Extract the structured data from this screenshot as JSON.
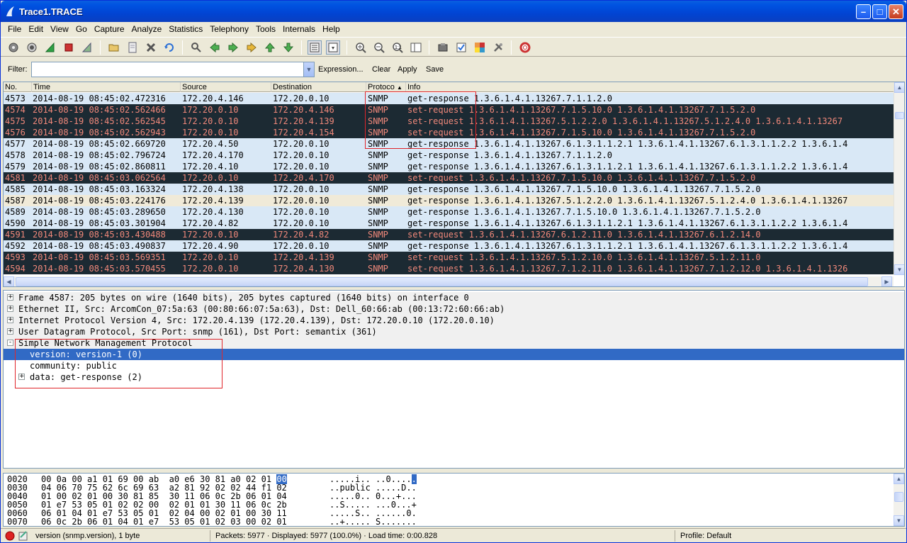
{
  "window": {
    "title": "Trace1.TRACE"
  },
  "menu": [
    "File",
    "Edit",
    "View",
    "Go",
    "Capture",
    "Analyze",
    "Statistics",
    "Telephony",
    "Tools",
    "Internals",
    "Help"
  ],
  "filter": {
    "label": "Filter:",
    "value": "",
    "expression": "Expression...",
    "clear": "Clear",
    "apply": "Apply",
    "save": "Save"
  },
  "packet_list": {
    "columns": [
      "No.",
      "Time",
      "Source",
      "Destination",
      "Protoco",
      "Info"
    ],
    "rows": [
      {
        "no": "4573",
        "time": "2014-08-19 08:45:02.472316",
        "src": "172.20.4.146",
        "dst": "172.20.0.10",
        "proto": "SNMP",
        "info": "get-response 1.3.6.1.4.1.13267.7.1.1.2.0",
        "kind": "resp"
      },
      {
        "no": "4574",
        "time": "2014-08-19 08:45:02.562466",
        "src": "172.20.0.10",
        "dst": "172.20.4.146",
        "proto": "SNMP",
        "info": "set-request 1.3.6.1.4.1.13267.7.1.5.10.0 1.3.6.1.4.1.13267.7.1.5.2.0",
        "kind": "req"
      },
      {
        "no": "4575",
        "time": "2014-08-19 08:45:02.562545",
        "src": "172.20.0.10",
        "dst": "172.20.4.139",
        "proto": "SNMP",
        "info": "set-request 1.3.6.1.4.1.13267.5.1.2.2.0 1.3.6.1.4.1.13267.5.1.2.4.0 1.3.6.1.4.1.13267",
        "kind": "req"
      },
      {
        "no": "4576",
        "time": "2014-08-19 08:45:02.562943",
        "src": "172.20.0.10",
        "dst": "172.20.4.154",
        "proto": "SNMP",
        "info": "set-request 1.3.6.1.4.1.13267.7.1.5.10.0 1.3.6.1.4.1.13267.7.1.5.2.0",
        "kind": "req"
      },
      {
        "no": "4577",
        "time": "2014-08-19 08:45:02.669720",
        "src": "172.20.4.50",
        "dst": "172.20.0.10",
        "proto": "SNMP",
        "info": "get-response 1.3.6.1.4.1.13267.6.1.3.1.1.2.1 1.3.6.1.4.1.13267.6.1.3.1.1.2.2 1.3.6.1.4",
        "kind": "resp"
      },
      {
        "no": "4578",
        "time": "2014-08-19 08:45:02.796724",
        "src": "172.20.4.170",
        "dst": "172.20.0.10",
        "proto": "SNMP",
        "info": "get-response 1.3.6.1.4.1.13267.7.1.1.2.0",
        "kind": "resp"
      },
      {
        "no": "4579",
        "time": "2014-08-19 08:45:02.860811",
        "src": "172.20.4.10",
        "dst": "172.20.0.10",
        "proto": "SNMP",
        "info": "get-response 1.3.6.1.4.1.13267.6.1.3.1.1.2.1 1.3.6.1.4.1.13267.6.1.3.1.1.2.2 1.3.6.1.4",
        "kind": "resp"
      },
      {
        "no": "4581",
        "time": "2014-08-19 08:45:03.062564",
        "src": "172.20.0.10",
        "dst": "172.20.4.170",
        "proto": "SNMP",
        "info": "set-request 1.3.6.1.4.1.13267.7.1.5.10.0 1.3.6.1.4.1.13267.7.1.5.2.0",
        "kind": "req"
      },
      {
        "no": "4585",
        "time": "2014-08-19 08:45:03.163324",
        "src": "172.20.4.138",
        "dst": "172.20.0.10",
        "proto": "SNMP",
        "info": "get-response 1.3.6.1.4.1.13267.7.1.5.10.0 1.3.6.1.4.1.13267.7.1.5.2.0",
        "kind": "resp"
      },
      {
        "no": "4587",
        "time": "2014-08-19 08:45:03.224176",
        "src": "172.20.4.139",
        "dst": "172.20.0.10",
        "proto": "SNMP",
        "info": "get-response 1.3.6.1.4.1.13267.5.1.2.2.0 1.3.6.1.4.1.13267.5.1.2.4.0 1.3.6.1.4.1.13267",
        "kind": "sel"
      },
      {
        "no": "4589",
        "time": "2014-08-19 08:45:03.289650",
        "src": "172.20.4.130",
        "dst": "172.20.0.10",
        "proto": "SNMP",
        "info": "get-response 1.3.6.1.4.1.13267.7.1.5.10.0 1.3.6.1.4.1.13267.7.1.5.2.0",
        "kind": "resp"
      },
      {
        "no": "4590",
        "time": "2014-08-19 08:45:03.301904",
        "src": "172.20.4.82",
        "dst": "172.20.0.10",
        "proto": "SNMP",
        "info": "get-response 1.3.6.1.4.1.13267.6.1.3.1.1.2.1 1.3.6.1.4.1.13267.6.1.3.1.1.2.2 1.3.6.1.4",
        "kind": "resp"
      },
      {
        "no": "4591",
        "time": "2014-08-19 08:45:03.430488",
        "src": "172.20.0.10",
        "dst": "172.20.4.82",
        "proto": "SNMP",
        "info": "set-request 1.3.6.1.4.1.13267.6.1.2.11.0 1.3.6.1.4.1.13267.6.1.2.14.0",
        "kind": "req"
      },
      {
        "no": "4592",
        "time": "2014-08-19 08:45:03.490837",
        "src": "172.20.4.90",
        "dst": "172.20.0.10",
        "proto": "SNMP",
        "info": "get-response 1.3.6.1.4.1.13267.6.1.3.1.1.2.1 1.3.6.1.4.1.13267.6.1.3.1.1.2.2 1.3.6.1.4",
        "kind": "resp"
      },
      {
        "no": "4593",
        "time": "2014-08-19 08:45:03.569351",
        "src": "172.20.0.10",
        "dst": "172.20.4.139",
        "proto": "SNMP",
        "info": "set-request 1.3.6.1.4.1.13267.5.1.2.10.0 1.3.6.1.4.1.13267.5.1.2.11.0",
        "kind": "req"
      },
      {
        "no": "4594",
        "time": "2014-08-19 08:45:03.570455",
        "src": "172.20.0.10",
        "dst": "172.20.4.130",
        "proto": "SNMP",
        "info": "set-request 1.3.6.1.4.1.13267.7.1.2.11.0 1.3.6.1.4.1.13267.7.1.2.12.0 1.3.6.1.4.1.1326",
        "kind": "req"
      }
    ]
  },
  "details": [
    {
      "text": "Frame 4587: 205 bytes on wire (1640 bits), 205 bytes captured (1640 bits) on interface 0",
      "exp": "+"
    },
    {
      "text": "Ethernet II, Src: ArcomCon_07:5a:63 (00:80:66:07:5a:63), Dst: Dell_60:66:ab (00:13:72:60:66:ab)",
      "exp": "+"
    },
    {
      "text": "Internet Protocol Version 4, Src: 172.20.4.139 (172.20.4.139), Dst: 172.20.0.10 (172.20.0.10)",
      "exp": "+"
    },
    {
      "text": "User Datagram Protocol, Src Port: snmp (161), Dst Port: semantix (361)",
      "exp": "+"
    },
    {
      "text": "Simple Network Management Protocol",
      "exp": "-"
    },
    {
      "text": "version: version-1 (0)",
      "exp": ""
    },
    {
      "text": "community: public",
      "exp": ""
    },
    {
      "text": "data: get-response (2)",
      "exp": "+"
    }
  ],
  "bytes": [
    {
      "off": "0020",
      "hex": "00 0a 00 a1 01 69 00 ab  a0 e6 30 81 a0 02 01 ",
      "sel": "00",
      "ascii": ".....i.. ..0....",
      "asel": "."
    },
    {
      "off": "0030",
      "hex": "04 06 70 75 62 6c 69 63  a2 81 92 02 02 44 f1 02",
      "sel": "",
      "ascii": "..public .....D..",
      "asel": ""
    },
    {
      "off": "0040",
      "hex": "01 00 02 01 00 30 81 85  30 11 06 0c 2b 06 01 04",
      "sel": "",
      "ascii": ".....0.. 0...+...",
      "asel": ""
    },
    {
      "off": "0050",
      "hex": "01 e7 53 05 01 02 02 00  02 01 01 30 11 06 0c 2b",
      "sel": "",
      "ascii": "..S..... ...0...+",
      "asel": ""
    },
    {
      "off": "0060",
      "hex": "06 01 04 01 e7 53 05 01  02 04 00 02 01 00 30 11",
      "sel": "",
      "ascii": ".....S.. ......0.",
      "asel": ""
    },
    {
      "off": "0070",
      "hex": "06 0c 2b 06 01 04 01 e7  53 05 01 02 03 00 02 01",
      "sel": "",
      "ascii": "..+..... S.......",
      "asel": ""
    }
  ],
  "status": {
    "field": "version (snmp.version), 1 byte",
    "packets": "Packets: 5977 · Displayed: 5977 (100.0%) · Load time: 0:00.828",
    "profile": "Profile: Default"
  },
  "colors": {
    "response_bg": "#d9e8f6",
    "request_bg": "#1c2a33",
    "request_fg": "#f0887a",
    "selection": "#316ac5",
    "highlight_box": "#e0252a"
  }
}
